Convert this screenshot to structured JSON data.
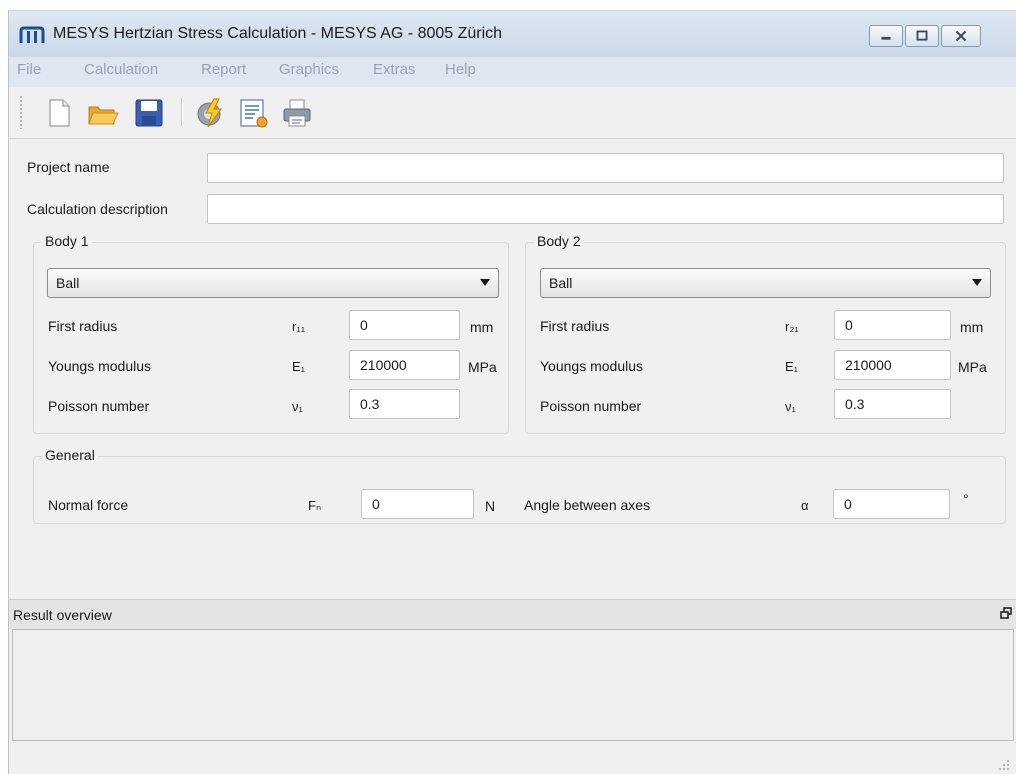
{
  "window": {
    "title": "MESYS Hertzian Stress Calculation - MESYS AG - 8005 Zürich",
    "logo": "mesys-logo",
    "controls": [
      "minimize-icon",
      "maximize-icon",
      "close-icon"
    ]
  },
  "menu": {
    "items": [
      "File",
      "Calculation",
      "Report",
      "Graphics",
      "Extras",
      "Help"
    ]
  },
  "toolbar": {
    "icons": [
      "new-document-icon",
      "open-folder-icon",
      "save-icon",
      "calculate-icon",
      "report-icon",
      "print-icon"
    ]
  },
  "project": {
    "name_label": "Project name",
    "name_value": "",
    "description_label": "Calculation description",
    "description_value": ""
  },
  "body1": {
    "title": "Body 1",
    "type": "Ball",
    "radius_label": "First radius",
    "radius_symbol": "r₁₁",
    "radius_value": "0",
    "radius_unit": "mm",
    "modulus_label": "Youngs modulus",
    "modulus_symbol": "E₁",
    "modulus_value": "210000",
    "modulus_unit": "MPa",
    "poisson_label": "Poisson number",
    "poisson_symbol": "ν₁",
    "poisson_value": "0.3"
  },
  "body2": {
    "title": "Body 2",
    "type": "Ball",
    "radius_label": "First radius",
    "radius_symbol": "r₂₁",
    "radius_value": "0",
    "radius_unit": "mm",
    "modulus_label": "Youngs modulus",
    "modulus_symbol": "E₁",
    "modulus_value": "210000",
    "modulus_unit": "MPa",
    "poisson_label": "Poisson number",
    "poisson_symbol": "ν₁",
    "poisson_value": "0.3"
  },
  "general": {
    "title": "General",
    "force_label": "Normal force",
    "force_symbol": "Fₙ",
    "force_value": "0",
    "force_unit": "N",
    "angle_label": "Angle between axes",
    "angle_symbol": "α",
    "angle_value": "0",
    "angle_unit": "°"
  },
  "results": {
    "title": "Result overview"
  },
  "colors": {
    "titlebar": "#cbd8e8",
    "menubar": "#dde6f1",
    "menu_text_disabled": "#9aa4b0",
    "background": "#f0f0f0"
  }
}
